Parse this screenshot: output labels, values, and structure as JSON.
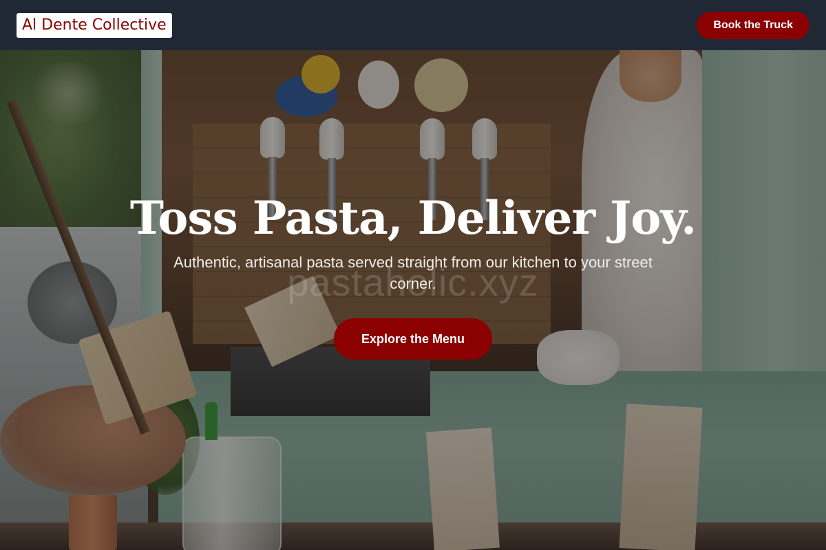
{
  "navbar": {
    "brand": "Al Dente Collective",
    "cta_label": "Book the Truck"
  },
  "hero": {
    "title": "Toss Pasta, Deliver Joy.",
    "subtitle": "Authentic, artisanal pasta served straight from our kitchen to your street corner.",
    "cta_label": "Explore the Menu",
    "watermark": "pastaholic.xyz"
  },
  "colors": {
    "brand_red": "#8b0000",
    "navbar_bg": "#202837",
    "text_light": "#ffffff"
  }
}
